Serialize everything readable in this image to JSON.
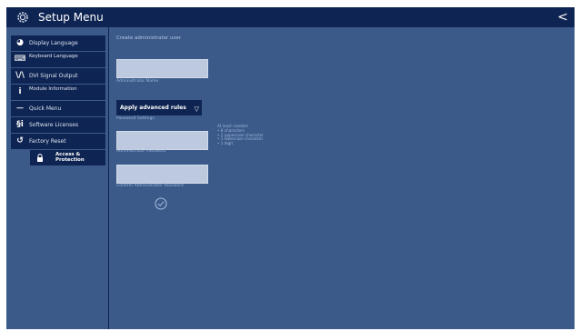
{
  "header": {
    "title": "Setup Menu",
    "back_glyph": "<",
    "settings_icon": "gear-icon"
  },
  "sidebar": {
    "items": [
      {
        "label": "Display Language",
        "icon": "globe-icon",
        "glyph": "◕"
      },
      {
        "label": "Keyboard Language",
        "icon": "keyboard-icon",
        "glyph": "⌨"
      },
      {
        "label": "DVI Signal Output",
        "icon": "signal-icon",
        "glyph": "\\/\\"
      },
      {
        "label": "Module Information",
        "icon": "info-icon",
        "glyph": "i"
      },
      {
        "label": "Quick Menu",
        "icon": "quick-menu-icon",
        "glyph": "⏤"
      },
      {
        "label": "Software Licenses",
        "icon": "license-icon",
        "glyph": "§i"
      },
      {
        "label": "Factory Reset",
        "icon": "reset-icon",
        "glyph": "↺"
      },
      {
        "label": "Access & Protection",
        "icon": "lock-icon",
        "glyph": "🔒",
        "active": true
      }
    ]
  },
  "main": {
    "heading": "Create administrator user",
    "admin_name": {
      "value": "",
      "caption": "Administrator Name"
    },
    "password_settings": {
      "selected": "Apply advanced rules",
      "caption": "Password Settings"
    },
    "password_rules": [
      "At least needed:",
      "• 8 characters",
      "• 1 uppercase character",
      "• 1 lowercase character",
      "• 1 digit"
    ],
    "admin_password": {
      "value": "",
      "caption": "Administrator Password"
    },
    "confirm_password": {
      "value": "",
      "caption": "Confirm Administrator Password"
    },
    "confirm_icon": "check-circle-icon"
  },
  "colors": {
    "background": "#3b5a8a",
    "header": "#0e2452",
    "button": "#0e2452",
    "field": "#bcc9df"
  }
}
